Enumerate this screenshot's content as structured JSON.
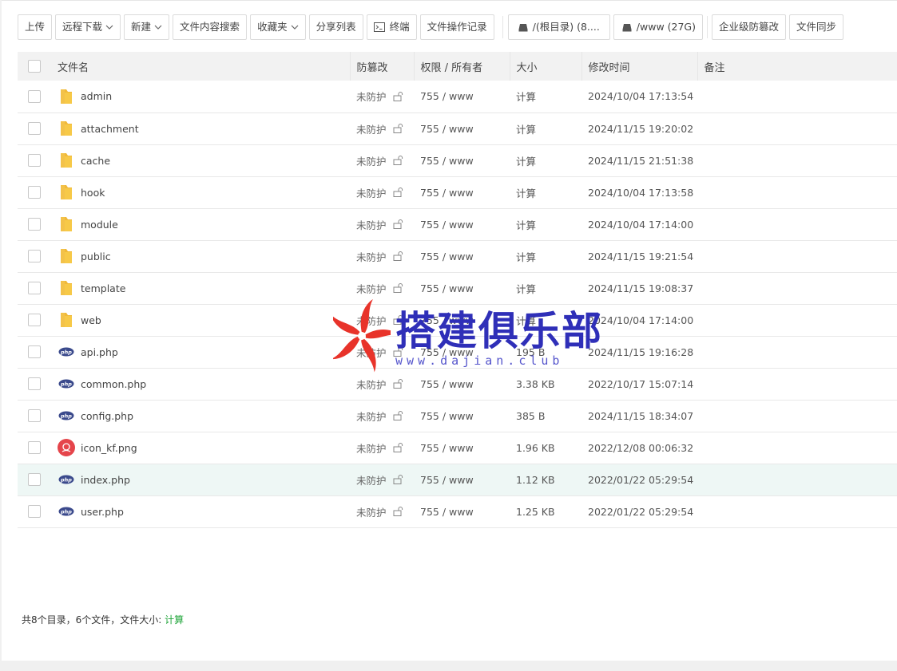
{
  "toolbar": {
    "upload": "上传",
    "remote_download": "远程下载",
    "new": "新建",
    "content_search": "文件内容搜索",
    "favorites": "收藏夹",
    "share_list": "分享列表",
    "terminal": "终端",
    "op_log": "文件操作记录",
    "root_disk": "/(根目录) (8....",
    "www_disk": "/www (27G)",
    "enterprise_tamper": "企业级防篡改",
    "file_sync": "文件同步"
  },
  "table": {
    "headers": {
      "name": "文件名",
      "tamper": "防篡改",
      "perm": "权限 / 所有者",
      "size": "大小",
      "mtime": "修改时间",
      "note": "备注"
    },
    "rows": [
      {
        "name": "admin",
        "type": "folder",
        "tamper": "未防护",
        "perm": "755 / www",
        "size": "计算",
        "mtime": "2024/10/04 17:13:54"
      },
      {
        "name": "attachment",
        "type": "folder",
        "tamper": "未防护",
        "perm": "755 / www",
        "size": "计算",
        "mtime": "2024/11/15 19:20:02"
      },
      {
        "name": "cache",
        "type": "folder",
        "tamper": "未防护",
        "perm": "755 / www",
        "size": "计算",
        "mtime": "2024/11/15 21:51:38"
      },
      {
        "name": "hook",
        "type": "folder",
        "tamper": "未防护",
        "perm": "755 / www",
        "size": "计算",
        "mtime": "2024/10/04 17:13:58"
      },
      {
        "name": "module",
        "type": "folder",
        "tamper": "未防护",
        "perm": "755 / www",
        "size": "计算",
        "mtime": "2024/10/04 17:14:00"
      },
      {
        "name": "public",
        "type": "folder",
        "tamper": "未防护",
        "perm": "755 / www",
        "size": "计算",
        "mtime": "2024/11/15 19:21:54"
      },
      {
        "name": "template",
        "type": "folder",
        "tamper": "未防护",
        "perm": "755 / www",
        "size": "计算",
        "mtime": "2024/11/15 19:08:37"
      },
      {
        "name": "web",
        "type": "folder",
        "tamper": "未防护",
        "perm": "755 / www",
        "size": "计算",
        "mtime": "2024/10/04 17:14:00"
      },
      {
        "name": "api.php",
        "type": "php",
        "tamper": "未防护",
        "perm": "755 / www",
        "size": "195 B",
        "mtime": "2024/11/15 19:16:28"
      },
      {
        "name": "common.php",
        "type": "php",
        "tamper": "未防护",
        "perm": "755 / www",
        "size": "3.38 KB",
        "mtime": "2022/10/17 15:07:14"
      },
      {
        "name": "config.php",
        "type": "php",
        "tamper": "未防护",
        "perm": "755 / www",
        "size": "385 B",
        "mtime": "2024/11/15 18:34:07"
      },
      {
        "name": "icon_kf.png",
        "type": "png",
        "tamper": "未防护",
        "perm": "755 / www",
        "size": "1.96 KB",
        "mtime": "2022/12/08 00:06:32"
      },
      {
        "name": "index.php",
        "type": "php",
        "tamper": "未防护",
        "perm": "755 / www",
        "size": "1.12 KB",
        "mtime": "2022/01/22 05:29:54",
        "highlight": true
      },
      {
        "name": "user.php",
        "type": "php",
        "tamper": "未防护",
        "perm": "755 / www",
        "size": "1.25 KB",
        "mtime": "2022/01/22 05:29:54"
      }
    ]
  },
  "footer": {
    "summary": "共8个目录，6个文件，文件大小:",
    "calc_link": "计算"
  },
  "watermark": {
    "title": "搭建俱乐部",
    "url": "www.dajian.club"
  },
  "colors": {
    "accent_green": "#20a53a",
    "folder_yellow": "#f7c948",
    "php_badge": "#3b4a8c",
    "watermark_blue": "#2f2fb8",
    "watermark_red": "#e8332a",
    "row_highlight": "#eef7f5"
  },
  "icons": {
    "chevron": "chevron-down-icon",
    "terminal": "terminal-icon",
    "disk": "disk-icon",
    "folder": "folder-icon",
    "php": "php-file-icon",
    "png": "image-file-icon",
    "unlock": "unlock-icon"
  }
}
